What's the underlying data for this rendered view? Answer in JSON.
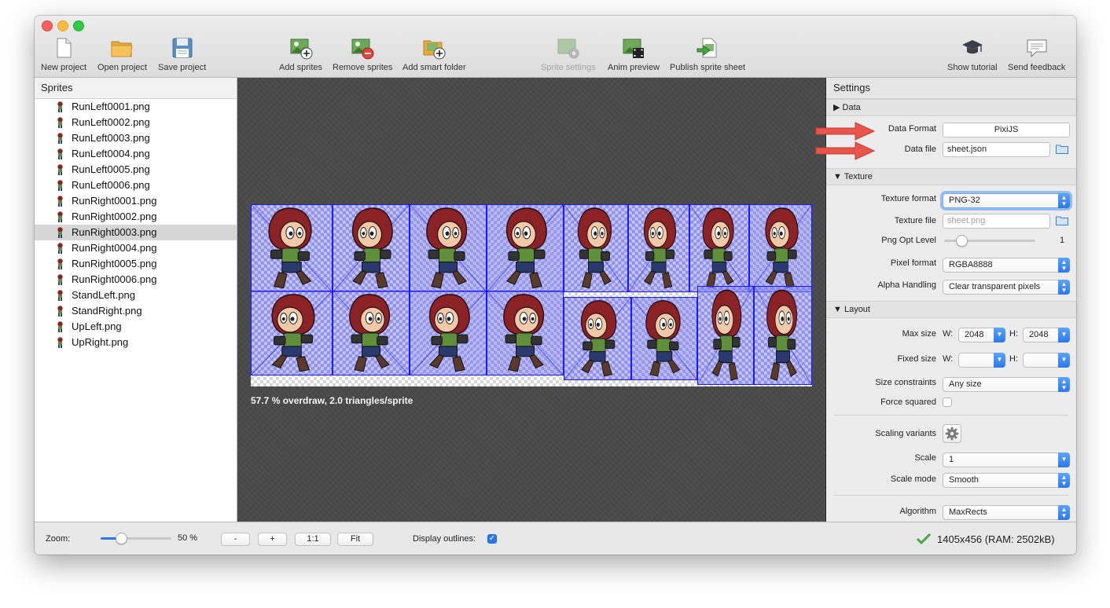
{
  "toolbar": {
    "new_project": "New project",
    "open_project": "Open project",
    "save_project": "Save project",
    "add_sprites": "Add sprites",
    "remove_sprites": "Remove sprites",
    "add_smart_folder": "Add smart folder",
    "sprite_settings": "Sprite settings",
    "anim_preview": "Anim preview",
    "publish_sprite_sheet": "Publish sprite sheet",
    "show_tutorial": "Show tutorial",
    "send_feedback": "Send feedback"
  },
  "sprites_panel": {
    "title": "Sprites",
    "selected": "RunRight0003.png",
    "items": [
      "RunLeft0001.png",
      "RunLeft0002.png",
      "RunLeft0003.png",
      "RunLeft0004.png",
      "RunLeft0005.png",
      "RunLeft0006.png",
      "RunRight0001.png",
      "RunRight0002.png",
      "RunRight0003.png",
      "RunRight0004.png",
      "RunRight0005.png",
      "RunRight0006.png",
      "StandLeft.png",
      "StandRight.png",
      "UpLeft.png",
      "UpRight.png"
    ]
  },
  "canvas": {
    "overdraw_text": "57.7 % overdraw, 2.0 triangles/sprite"
  },
  "settings": {
    "title": "Settings",
    "data_section": "Data",
    "data_format_label": "Data Format",
    "data_format_value": "PixiJS",
    "data_file_label": "Data file",
    "data_file_value": "sheet.json",
    "texture_section": "Texture",
    "texture_format_label": "Texture format",
    "texture_format_value": "PNG-32",
    "texture_file_label": "Texture file",
    "texture_file_value": "sheet.png",
    "png_opt_label": "Png Opt Level",
    "png_opt_value": "1",
    "png_opt_level_fraction": 0.15,
    "pixel_format_label": "Pixel format",
    "pixel_format_value": "RGBA8888",
    "alpha_label": "Alpha Handling",
    "alpha_value": "Clear transparent pixels",
    "layout_section": "Layout",
    "max_size_label": "Max size",
    "w_label": "W:",
    "h_label": "H:",
    "max_w": "2048",
    "max_h": "2048",
    "fixed_size_label": "Fixed size",
    "fixed_w": "",
    "fixed_h": "",
    "size_constraints_label": "Size constraints",
    "size_constraints_value": "Any size",
    "force_squared_label": "Force squared",
    "force_squared": false,
    "scaling_variants_label": "Scaling variants",
    "scale_label": "Scale",
    "scale_value": "1",
    "scale_mode_label": "Scale mode",
    "scale_mode_value": "Smooth",
    "algorithm_label": "Algorithm",
    "algorithm_value": "MaxRects"
  },
  "statusbar": {
    "zoom_label": "Zoom:",
    "zoom_value": "50 %",
    "zoom_fraction": 0.5,
    "btn_minus": "-",
    "btn_plus": "+",
    "btn_1to1": "1:1",
    "btn_fit": "Fit",
    "display_outlines_label": "Display outlines:",
    "display_outlines": true,
    "status_text": "1405x456 (RAM: 2502kB)"
  },
  "colors": {
    "accent": "#2a78ec",
    "annotation_arrow": "#e8554a",
    "sprite_outline": "#1a1aff",
    "sprite_hair": "#8b2326",
    "sprite_shirt": "#5f8f3a",
    "sprite_pants": "#2b3a6e"
  },
  "icons": {
    "new_project": "document-icon",
    "open_project": "folder-icon",
    "save_project": "floppy-disk-icon",
    "add_sprites": "image-plus-icon",
    "remove_sprites": "image-minus-icon",
    "add_smart_folder": "folder-plus-icon",
    "sprite_settings": "image-gear-icon",
    "anim_preview": "film-icon",
    "publish": "publish-arrow-icon",
    "tutorial": "graduation-cap-icon",
    "feedback": "speech-bubble-icon",
    "status_ok": "checkmark-icon"
  }
}
